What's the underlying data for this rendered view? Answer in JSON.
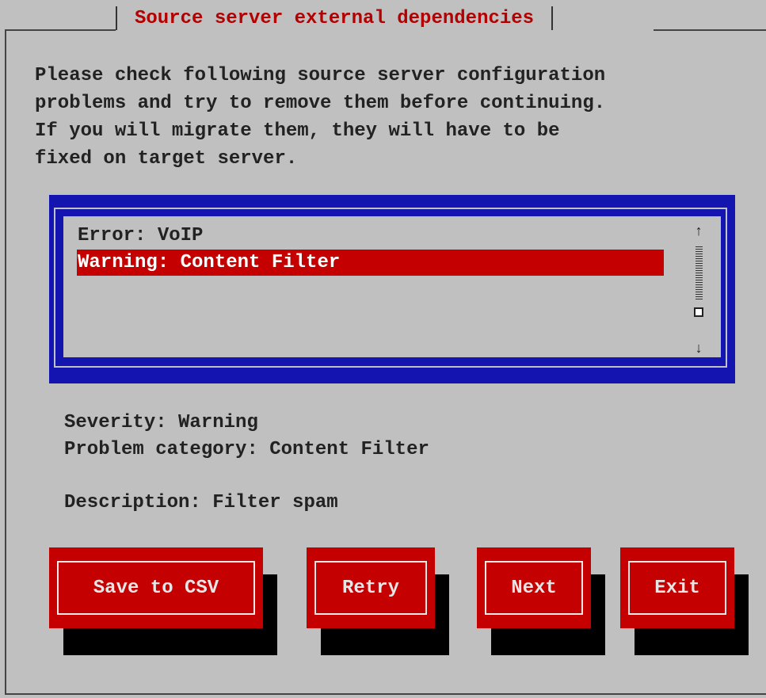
{
  "dialog": {
    "title": "Source server external dependencies",
    "intro_lines": [
      "Please check following source server configuration",
      "problems and try to remove them before continuing.",
      "If you will migrate them, they will have to be",
      "fixed on target server."
    ]
  },
  "problems_list": {
    "items": [
      {
        "label": "Error: VoIP",
        "selected": false
      },
      {
        "label": "Warning: Content Filter",
        "selected": true
      }
    ],
    "scroll_up_glyph": "↑",
    "scroll_down_glyph": "↓"
  },
  "details": {
    "severity": "Severity: Warning",
    "category": "Problem category: Content Filter",
    "description": "Description: Filter spam"
  },
  "buttons": {
    "save_csv": "Save to CSV",
    "retry": "Retry",
    "next": "Next",
    "exit": "Exit"
  },
  "colors": {
    "background": "#c0c0c0",
    "accent_red": "#c40000",
    "list_border_blue": "#1414b0",
    "title_red": "#b30000"
  }
}
